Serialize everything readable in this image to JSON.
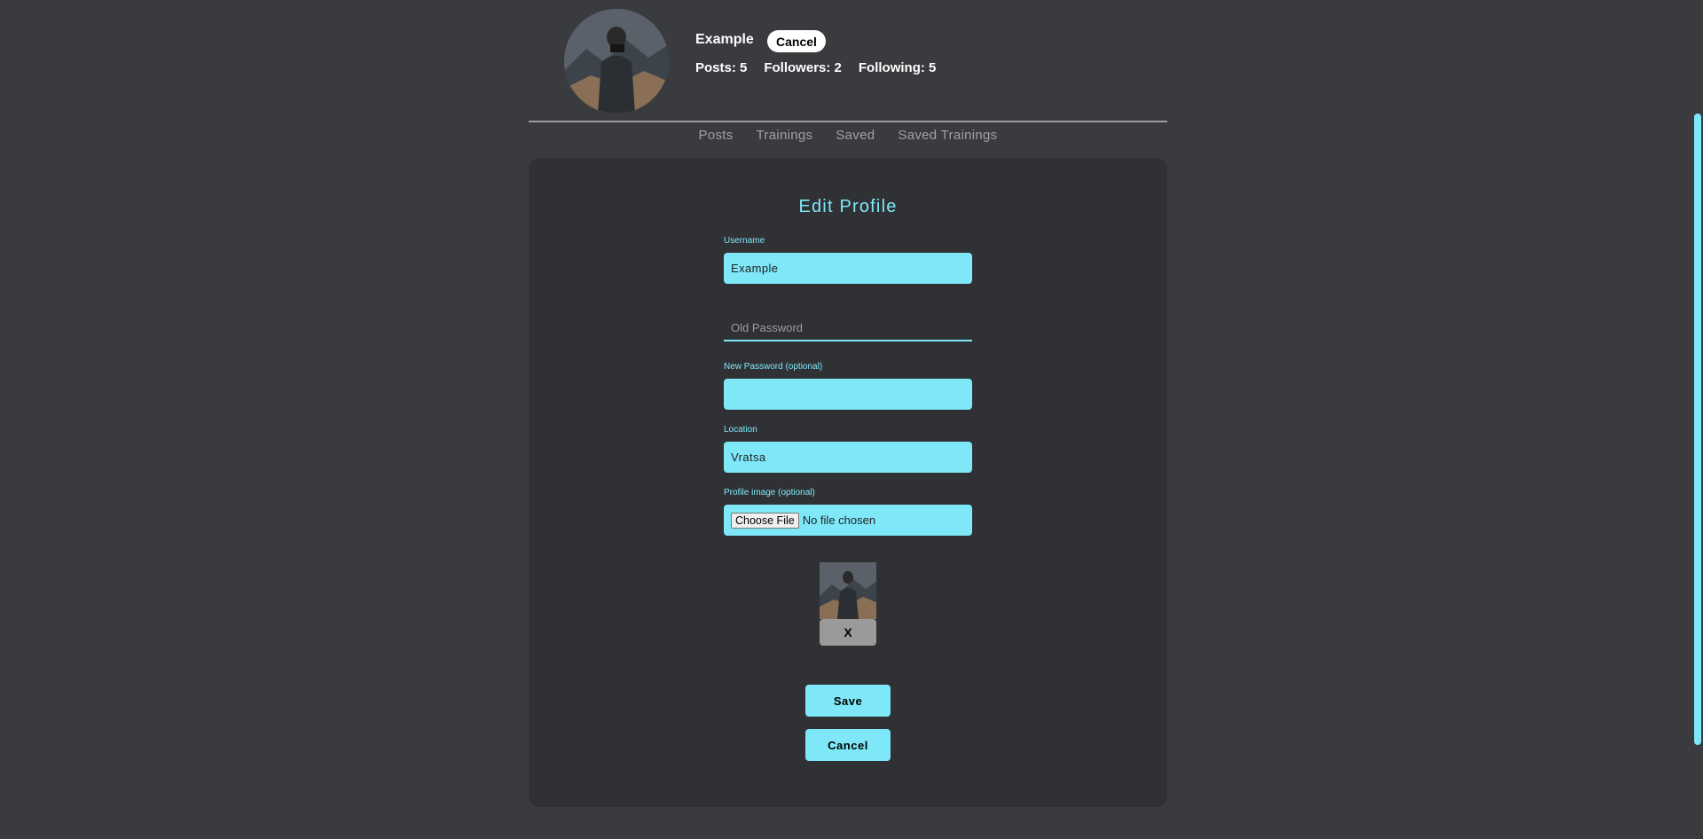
{
  "profile": {
    "username": "Example",
    "header_cancel_label": "Cancel",
    "stats": {
      "posts": "Posts: 5",
      "followers": "Followers: 2",
      "following": "Following: 5"
    }
  },
  "tabs": [
    "Posts",
    "Trainings",
    "Saved",
    "Saved Trainings"
  ],
  "form": {
    "title": "Edit Profile",
    "username_label": "Username",
    "username_value": "Example",
    "old_password_placeholder": "Old Password",
    "new_password_label": "New Password (optional)",
    "new_password_value": "",
    "location_label": "Location",
    "location_value": "Vratsa",
    "profile_image_label": "Profile image (optional)",
    "choose_file_label": "Choose File",
    "no_file_text": "No file chosen",
    "remove_image_label": "X",
    "save_label": "Save",
    "cancel_label": "Cancel"
  },
  "colors": {
    "accent": "#7ee8f8",
    "background": "#3a3b3f",
    "card": "#303135"
  }
}
